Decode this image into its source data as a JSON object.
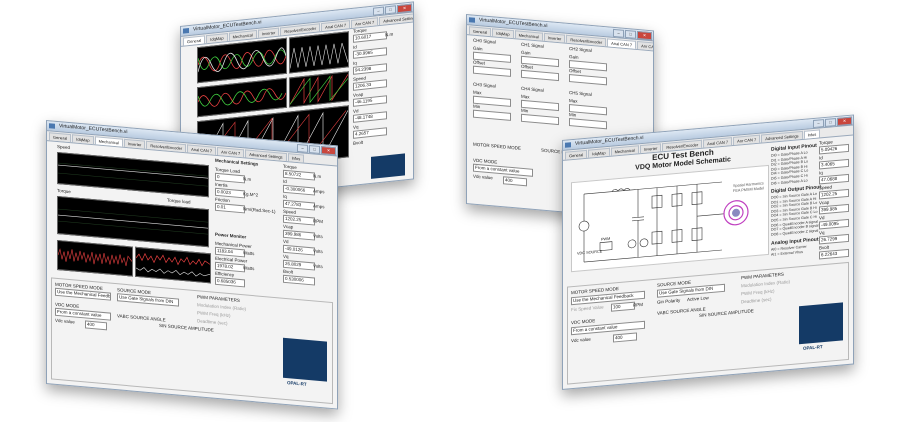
{
  "colors": {
    "accent": "#143a66",
    "titlebar": "#c8d7e8",
    "plot_bg": "#000000",
    "close": "#c9463d"
  },
  "icons": [
    "app-icon",
    "minimize-icon",
    "maximize-icon",
    "close-icon",
    "logo-icon"
  ],
  "windows": {
    "w1": {
      "title": "VirtualMotor_ECUTestBench.vi",
      "tabs": [
        "General",
        "IdqMap",
        "Mechanical",
        "Inverter",
        "Resolver/Encoder",
        "Anal CAN 7",
        "Anr CAN 7",
        "Advanced Settings",
        "Infos"
      ],
      "torque_label": "Torque",
      "torque_value": "10.6017",
      "torque_unit": "N.m",
      "id_label": "Id",
      "id_value": "-30.9965",
      "iq_label": "Iq",
      "iq_value": "94.2398",
      "speed_label": "Speed",
      "speed_value": "1206.33",
      "vcap_label": "Vcap",
      "vcap_value": "-46.1195",
      "vd_label": "Vd",
      "vd_value": "-48.1748",
      "vq_label": "Vq",
      "vq_value": "4.2657",
      "bvolt_label": "Bvolt"
    },
    "w2": {
      "title": "VirtualMotor_ECUTestBench.vi",
      "tabs": [
        "General",
        "IdqMap",
        "Mechanical",
        "Inverter",
        "Resolver/Encoder",
        "Anal CAN 7",
        "Anr CAN 7",
        "Advanced Settings",
        "Infos"
      ],
      "can_headers": [
        "CH0 Signal",
        "CH1 Signal",
        "CH2 Signal",
        "CH3 Signal",
        "CH4 Signal",
        "CH5 Signal"
      ],
      "fields": [
        "Gain",
        "Offset",
        "Max",
        "Min"
      ],
      "motor_speed_mode": "MOTOR SPEED MODE",
      "vdc_mode": "VDC MODE",
      "source_mode": "SOURCE MODE",
      "vdc_mode_value": "From a constant value",
      "vdc_value_label": "Vdc value",
      "vdc_value": "400"
    },
    "w3": {
      "title": "VirtualMotor_ECUTestBench.vi",
      "tabs": [
        "General",
        "IdqMap",
        "Mechanical",
        "Inverter",
        "Resolver/Encoder",
        "Anal CAN 7",
        "Anr CAN 7",
        "Advanced Settings",
        "Infos"
      ],
      "mech_title": "Mechanical Settings",
      "torque_load_label": "Torque Load",
      "torque_load_value": "0",
      "torque_load_unit": "N.m",
      "inertia_label": "Inertia",
      "inertia_value": "0.0023",
      "inertia_unit": "Kg.M^2",
      "friction_label": "Friction",
      "friction_value": "0.01",
      "friction_unit": "Nm/(Rad.Sec-1)",
      "power_title": "Power Monitor",
      "mech_power_label": "Mechanical Power",
      "mech_power_value": "1183.04",
      "mech_power_unit": "Watts",
      "elec_power_label": "Electrical Power",
      "elec_power_value": "1978.02",
      "elec_power_unit": "Watts",
      "efficiency_label": "Efficiency",
      "efficiency_value": "0.685036",
      "torque_label": "Torque",
      "torque_value": "8.50722",
      "torque_unit": "N.m",
      "id_label": "Id",
      "id_value": "-0.300066",
      "id_unit": "Amps",
      "iq_label": "Iq",
      "iq_value": "47.2783",
      "iq_unit": "Amps",
      "speed_label": "Speed",
      "speed_value": "1202.25",
      "speed_unit": "RPM",
      "vcap_label": "Vcap",
      "vcap_value": "399.986",
      "vcap_unit": "Volts",
      "vd_label": "Vd",
      "vd_value": "-49.0126",
      "vd_unit": "Volts",
      "vq_label": "Vq",
      "vq_value": "26.8029",
      "vq_unit": "Volts",
      "bvolt_label": "Bvolt",
      "bvolt_value": "0.530006",
      "plot1_title": "Speed",
      "plot2_title": "Torque",
      "plot2_legend": "Torque load",
      "motor_speed_mode": "MOTOR SPEED MODE",
      "motor_speed_value": "Use the Mechanical Feedback",
      "vdc_mode": "VDC MODE",
      "vdc_mode_value": "From a constant value",
      "vdc_value_label": "Vdc value",
      "vdc_value": "400",
      "source_mode": "SOURCE MODE",
      "source_mode_value": "Use Gate Signals from DIN",
      "vabc_angle": "VABC SOURCE ANGLE",
      "sin_amp": "SIN SOURCE AMPLITUDE",
      "pwm_params": "PWM PARAMETERS",
      "mod_index": "Modulation Index (Ratio)",
      "pwm_freq": "PWM Freq (kHz)",
      "deadtime": "Deadtime (sec)",
      "company": "OPAL-RT"
    },
    "w4": {
      "title": "VirtualMotor_ECUTestBench.vi",
      "tabs": [
        "General",
        "IdqMap",
        "Mechanical",
        "Inverter",
        "Resolver/Encoder",
        "Anal CAN 7",
        "Anr CAN 7",
        "Advanced Settings",
        "Infos"
      ],
      "heading1": "ECU Test Bench",
      "heading2": "VDQ Motor Model Schematic",
      "dig_in_title": "Digital Input Pinout",
      "dig_in_list": "DI0 = Gate/Phase A Lo\nDI1 = Gate/Phase A Hi\nDI2 = Gate/Phase B Lo\nDI3 = Gate/Phase B Hi\nDI4 = Gate/Phase C Lo\nDI5 = Gate/Phase C Hi\nDI6 = Gate/Phase A Lo",
      "dig_out_title": "Digital Output Pinout",
      "dig_out_list": "DO0 = Sin Source Gate A Lo\nDO1 = Sin Source Gate A Hi\nDO2 = Sin Source Gate B Lo\nDO3 = Sin Source Gate B Hi\nDO4 = Sin Source Gate C Lo\nDO5 = Sin Source Gate C Hi\nDO6 = QuadEncoder A signal\nDO7 = QuadEncoder B signal\nDO8 = QuadEncoder Z signal",
      "analog_in_title": "Analog Input Pinout",
      "analog_in_list": "AI0 = Resolver Carrier\nAI1 = External Vbus",
      "torque_label": "Torque",
      "torque_value": "5.09426",
      "id_label": "Id",
      "id_value": "3.4065",
      "iq_label": "Iq",
      "iq_value": "47.0688",
      "speed_label": "Speed",
      "speed_value": "1202.25",
      "vcap_label": "Vcap",
      "vcap_value": "399.985",
      "vd_label": "Vd",
      "vd_value": "-49.0095",
      "vq_label": "Vq",
      "vq_value": "26.7299",
      "bvolt_label": "Bvolt",
      "bvolt_value": "6.22643",
      "motor_label": "Spatial Harmonics\nFEA PMSM Model",
      "vdc_source": "VDC SOURCE",
      "pwm_label": "PWM",
      "motor_speed_mode": "MOTOR SPEED MODE",
      "motor_speed_value": "Use the Mechanical Feedback",
      "fix_speed_label": "Fix Speed Value",
      "fix_speed_value": "100",
      "fix_speed_unit": "RPM",
      "vdc_mode": "VDC MODE",
      "vdc_mode_value": "From a constant value",
      "vdc_value_label": "Vdc value",
      "vdc_value": "400",
      "source_mode": "SOURCE MODE",
      "source_mode_value": "Use Gate Signals from DIN",
      "polarity_label": "Gin Polarity",
      "polarity_value": "Active Low",
      "vabc_angle": "VABC SOURCE ANGLE",
      "sin_amp": "SIN SOURCE AMPLITUDE",
      "pwm_params": "PWM PARAMETERS",
      "mod_index": "Modulation Index (Ratio)",
      "pwm_freq": "PWM Freq (kHz)",
      "deadtime": "Deadtime (sec)",
      "company": "OPAL-RT"
    }
  }
}
